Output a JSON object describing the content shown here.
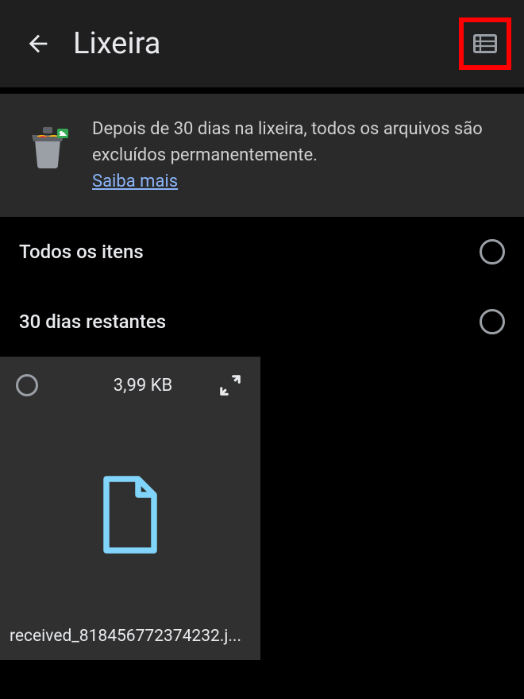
{
  "header": {
    "title": "Lixeira"
  },
  "banner": {
    "message": "Depois de 30 dias na lixeira, todos os arquivos são excluídos permanentemente.",
    "learn_more": "Saiba mais"
  },
  "sections": {
    "all_items": "Todos os itens",
    "days_remaining": "30 dias restantes"
  },
  "files": [
    {
      "size": "3,99 KB",
      "name": "received_818456772374232.j..."
    }
  ]
}
